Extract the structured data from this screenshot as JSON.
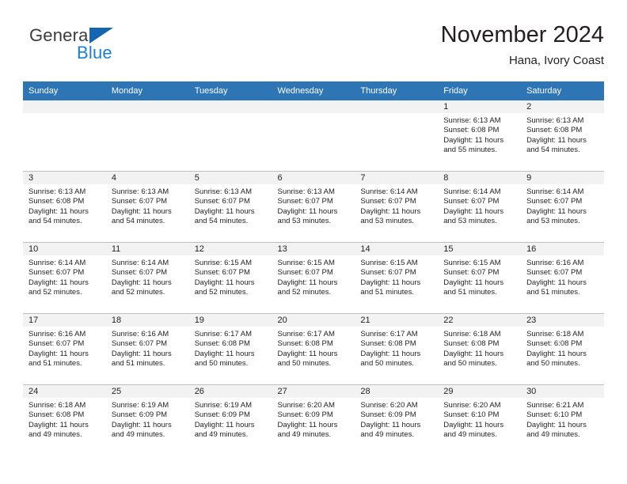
{
  "brand": {
    "name_part1": "General",
    "name_part2": "Blue",
    "triangle_color": "#1466b0",
    "blue_color": "#1b7fd4"
  },
  "header": {
    "title": "November 2024",
    "location": "Hana, Ivory Coast"
  },
  "theme": {
    "header_bg": "#2e75b6",
    "header_text": "#ffffff",
    "daynum_band_bg": "#f2f2f2",
    "grid_line": "#bfbfbf",
    "body_text": "#231f20"
  },
  "weekday_headers": [
    "Sunday",
    "Monday",
    "Tuesday",
    "Wednesday",
    "Thursday",
    "Friday",
    "Saturday"
  ],
  "labels": {
    "sunrise_prefix": "Sunrise:",
    "sunset_prefix": "Sunset:",
    "daylight_prefix": "Daylight:"
  },
  "weeks": [
    [
      {
        "day": "",
        "empty": true,
        "line1": "",
        "line2": "",
        "line3": "",
        "line4": ""
      },
      {
        "day": "",
        "empty": true,
        "line1": "",
        "line2": "",
        "line3": "",
        "line4": ""
      },
      {
        "day": "",
        "empty": true,
        "line1": "",
        "line2": "",
        "line3": "",
        "line4": ""
      },
      {
        "day": "",
        "empty": true,
        "line1": "",
        "line2": "",
        "line3": "",
        "line4": ""
      },
      {
        "day": "",
        "empty": true,
        "line1": "",
        "line2": "",
        "line3": "",
        "line4": ""
      },
      {
        "day": "1",
        "empty": false,
        "line1": "Sunrise: 6:13 AM",
        "line2": "Sunset: 6:08 PM",
        "line3": "Daylight: 11 hours",
        "line4": "and 55 minutes."
      },
      {
        "day": "2",
        "empty": false,
        "line1": "Sunrise: 6:13 AM",
        "line2": "Sunset: 6:08 PM",
        "line3": "Daylight: 11 hours",
        "line4": "and 54 minutes."
      }
    ],
    [
      {
        "day": "3",
        "empty": false,
        "line1": "Sunrise: 6:13 AM",
        "line2": "Sunset: 6:08 PM",
        "line3": "Daylight: 11 hours",
        "line4": "and 54 minutes."
      },
      {
        "day": "4",
        "empty": false,
        "line1": "Sunrise: 6:13 AM",
        "line2": "Sunset: 6:07 PM",
        "line3": "Daylight: 11 hours",
        "line4": "and 54 minutes."
      },
      {
        "day": "5",
        "empty": false,
        "line1": "Sunrise: 6:13 AM",
        "line2": "Sunset: 6:07 PM",
        "line3": "Daylight: 11 hours",
        "line4": "and 54 minutes."
      },
      {
        "day": "6",
        "empty": false,
        "line1": "Sunrise: 6:13 AM",
        "line2": "Sunset: 6:07 PM",
        "line3": "Daylight: 11 hours",
        "line4": "and 53 minutes."
      },
      {
        "day": "7",
        "empty": false,
        "line1": "Sunrise: 6:14 AM",
        "line2": "Sunset: 6:07 PM",
        "line3": "Daylight: 11 hours",
        "line4": "and 53 minutes."
      },
      {
        "day": "8",
        "empty": false,
        "line1": "Sunrise: 6:14 AM",
        "line2": "Sunset: 6:07 PM",
        "line3": "Daylight: 11 hours",
        "line4": "and 53 minutes."
      },
      {
        "day": "9",
        "empty": false,
        "line1": "Sunrise: 6:14 AM",
        "line2": "Sunset: 6:07 PM",
        "line3": "Daylight: 11 hours",
        "line4": "and 53 minutes."
      }
    ],
    [
      {
        "day": "10",
        "empty": false,
        "line1": "Sunrise: 6:14 AM",
        "line2": "Sunset: 6:07 PM",
        "line3": "Daylight: 11 hours",
        "line4": "and 52 minutes."
      },
      {
        "day": "11",
        "empty": false,
        "line1": "Sunrise: 6:14 AM",
        "line2": "Sunset: 6:07 PM",
        "line3": "Daylight: 11 hours",
        "line4": "and 52 minutes."
      },
      {
        "day": "12",
        "empty": false,
        "line1": "Sunrise: 6:15 AM",
        "line2": "Sunset: 6:07 PM",
        "line3": "Daylight: 11 hours",
        "line4": "and 52 minutes."
      },
      {
        "day": "13",
        "empty": false,
        "line1": "Sunrise: 6:15 AM",
        "line2": "Sunset: 6:07 PM",
        "line3": "Daylight: 11 hours",
        "line4": "and 52 minutes."
      },
      {
        "day": "14",
        "empty": false,
        "line1": "Sunrise: 6:15 AM",
        "line2": "Sunset: 6:07 PM",
        "line3": "Daylight: 11 hours",
        "line4": "and 51 minutes."
      },
      {
        "day": "15",
        "empty": false,
        "line1": "Sunrise: 6:15 AM",
        "line2": "Sunset: 6:07 PM",
        "line3": "Daylight: 11 hours",
        "line4": "and 51 minutes."
      },
      {
        "day": "16",
        "empty": false,
        "line1": "Sunrise: 6:16 AM",
        "line2": "Sunset: 6:07 PM",
        "line3": "Daylight: 11 hours",
        "line4": "and 51 minutes."
      }
    ],
    [
      {
        "day": "17",
        "empty": false,
        "line1": "Sunrise: 6:16 AM",
        "line2": "Sunset: 6:07 PM",
        "line3": "Daylight: 11 hours",
        "line4": "and 51 minutes."
      },
      {
        "day": "18",
        "empty": false,
        "line1": "Sunrise: 6:16 AM",
        "line2": "Sunset: 6:07 PM",
        "line3": "Daylight: 11 hours",
        "line4": "and 51 minutes."
      },
      {
        "day": "19",
        "empty": false,
        "line1": "Sunrise: 6:17 AM",
        "line2": "Sunset: 6:08 PM",
        "line3": "Daylight: 11 hours",
        "line4": "and 50 minutes."
      },
      {
        "day": "20",
        "empty": false,
        "line1": "Sunrise: 6:17 AM",
        "line2": "Sunset: 6:08 PM",
        "line3": "Daylight: 11 hours",
        "line4": "and 50 minutes."
      },
      {
        "day": "21",
        "empty": false,
        "line1": "Sunrise: 6:17 AM",
        "line2": "Sunset: 6:08 PM",
        "line3": "Daylight: 11 hours",
        "line4": "and 50 minutes."
      },
      {
        "day": "22",
        "empty": false,
        "line1": "Sunrise: 6:18 AM",
        "line2": "Sunset: 6:08 PM",
        "line3": "Daylight: 11 hours",
        "line4": "and 50 minutes."
      },
      {
        "day": "23",
        "empty": false,
        "line1": "Sunrise: 6:18 AM",
        "line2": "Sunset: 6:08 PM",
        "line3": "Daylight: 11 hours",
        "line4": "and 50 minutes."
      }
    ],
    [
      {
        "day": "24",
        "empty": false,
        "line1": "Sunrise: 6:18 AM",
        "line2": "Sunset: 6:08 PM",
        "line3": "Daylight: 11 hours",
        "line4": "and 49 minutes."
      },
      {
        "day": "25",
        "empty": false,
        "line1": "Sunrise: 6:19 AM",
        "line2": "Sunset: 6:09 PM",
        "line3": "Daylight: 11 hours",
        "line4": "and 49 minutes."
      },
      {
        "day": "26",
        "empty": false,
        "line1": "Sunrise: 6:19 AM",
        "line2": "Sunset: 6:09 PM",
        "line3": "Daylight: 11 hours",
        "line4": "and 49 minutes."
      },
      {
        "day": "27",
        "empty": false,
        "line1": "Sunrise: 6:20 AM",
        "line2": "Sunset: 6:09 PM",
        "line3": "Daylight: 11 hours",
        "line4": "and 49 minutes."
      },
      {
        "day": "28",
        "empty": false,
        "line1": "Sunrise: 6:20 AM",
        "line2": "Sunset: 6:09 PM",
        "line3": "Daylight: 11 hours",
        "line4": "and 49 minutes."
      },
      {
        "day": "29",
        "empty": false,
        "line1": "Sunrise: 6:20 AM",
        "line2": "Sunset: 6:10 PM",
        "line3": "Daylight: 11 hours",
        "line4": "and 49 minutes."
      },
      {
        "day": "30",
        "empty": false,
        "line1": "Sunrise: 6:21 AM",
        "line2": "Sunset: 6:10 PM",
        "line3": "Daylight: 11 hours",
        "line4": "and 49 minutes."
      }
    ]
  ]
}
